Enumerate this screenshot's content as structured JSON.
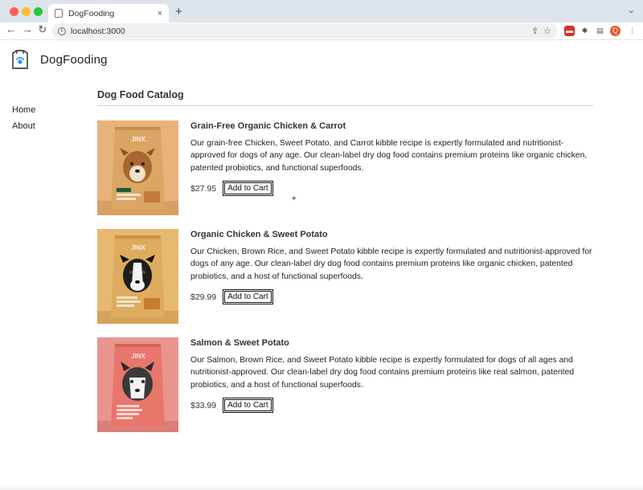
{
  "browser": {
    "tab_title": "DogFooding",
    "tab_close": "×",
    "new_tab": "+",
    "tabs_menu": "⌄",
    "url": "localhost:3000",
    "window_dots": {
      "close": "#ff5f57",
      "minimize": "#febc2e",
      "maximize": "#28c840"
    },
    "profile_initial": "Q",
    "profile_color": "#e8542e",
    "extensions": [
      {
        "icon": "pdf-extension-icon",
        "color": "#d93025",
        "glyph": "▬"
      },
      {
        "icon": "puzzle-extension-icon",
        "color": "#444444",
        "glyph": "✱"
      },
      {
        "icon": "sidepanel-extension-icon",
        "color": "#555555",
        "glyph": "▤"
      }
    ]
  },
  "app": {
    "brand": "DogFooding",
    "accent": "#1e90ff"
  },
  "nav": {
    "items": [
      {
        "label": "Home"
      },
      {
        "label": "About"
      }
    ]
  },
  "catalog": {
    "title": "Dog Food Catalog",
    "add_label": "Add to Cart",
    "products": [
      {
        "name": "Grain-Free Organic Chicken & Carrot",
        "description": "Our grain-free Chicken, Sweet Potato, and Carrot kibble recipe is expertly formulated and nutritionist-approved for dogs of any age. Our clean-label dry dog food contains premium proteins like organic chicken, patented probiotics, and functional superfoods.",
        "price": "$27.95",
        "image_colors": {
          "bg": "#e8b27a",
          "bag": "#d9a15f",
          "label": "#f0e2cf"
        },
        "brand_mark": "JINX"
      },
      {
        "name": "Organic Chicken & Sweet Potato",
        "description": "Our Chicken, Brown Rice, and Sweet Potato kibble recipe is expertly formulated and nutritionist-approved for dogs of any age. Our clean-label dry dog food contains premium proteins like organic chicken, patented probiotics, and a host of functional superfoods.",
        "price": "$29.99",
        "image_colors": {
          "bg": "#e5b970",
          "bag": "#dca659",
          "label": "#f2e4c8"
        },
        "brand_mark": "JINX"
      },
      {
        "name": "Salmon & Sweet Potato",
        "description": "Our Salmon, Brown Rice, and Sweet Potato kibble recipe is expertly formulated for dogs of all ages and nutritionist-approved. Our clean-label dry dog food contains premium proteins like real salmon, patented probiotics, and a host of functional superfoods.",
        "price": "$33.99",
        "image_colors": {
          "bg": "#e9958d",
          "bag": "#e8766b",
          "label": "#f6d6cf"
        },
        "brand_mark": "JINX"
      }
    ]
  }
}
